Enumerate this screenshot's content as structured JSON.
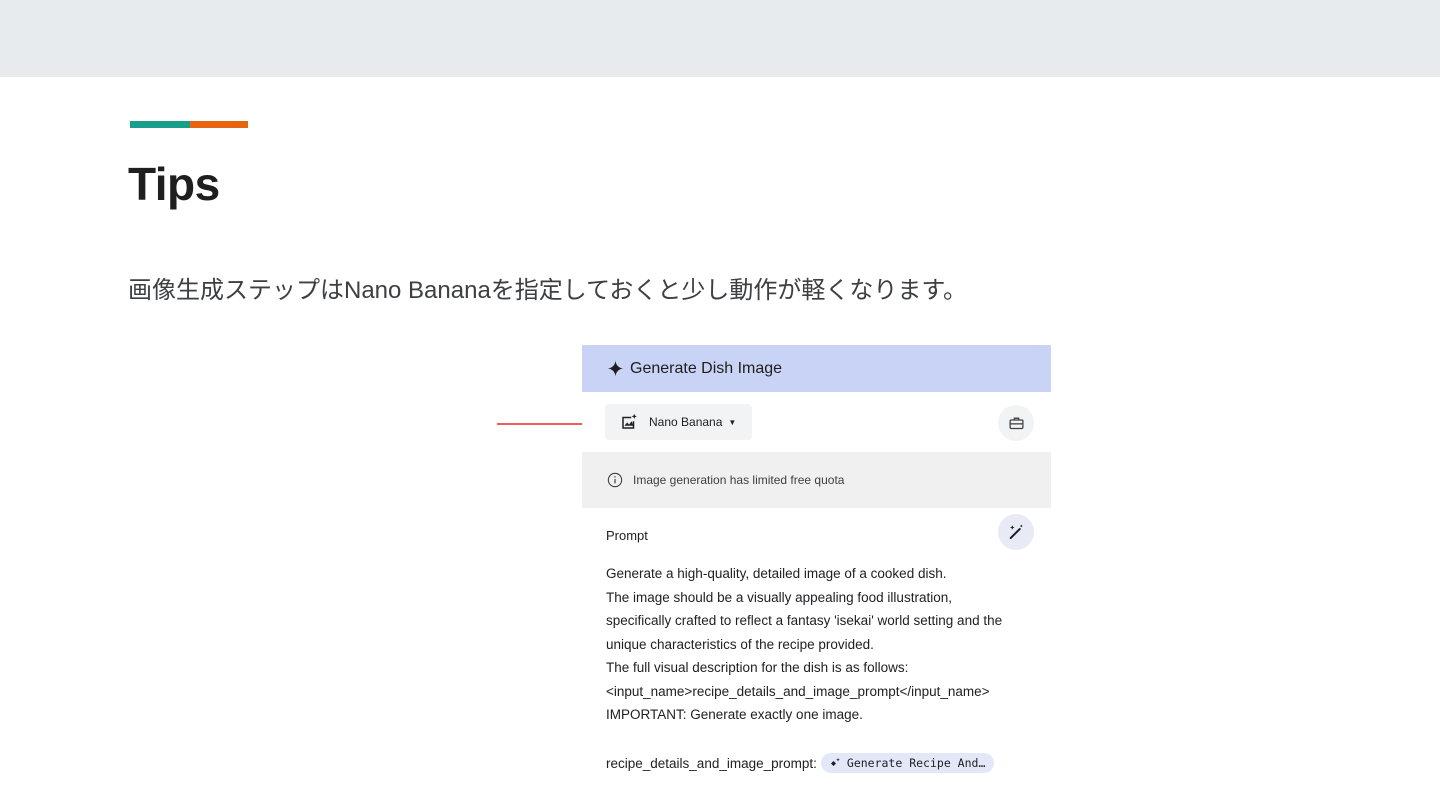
{
  "slide": {
    "title": "Tips",
    "subtitle": "画像生成ステップはNano Bananaを指定しておくと少し動作が軽くなります。",
    "accent_colors": [
      "#1a9e8c",
      "#e8650f"
    ],
    "pointer_color": "#e8262c"
  },
  "panel": {
    "header_title": "Generate Dish Image",
    "header_icon": "sparkle-icon",
    "model_selector": {
      "label": "Nano Banana",
      "icon": "image-generation-icon"
    },
    "toolbar_icon": "toolbox-icon",
    "notice": {
      "icon": "info-icon",
      "text": "Image generation has limited free quota"
    },
    "prompt": {
      "label": "Prompt",
      "action_icon": "magic-wand-icon",
      "lines": [
        "Generate a high-quality, detailed image of a cooked dish.",
        "The image should be a visually appealing food illustration,",
        "specifically crafted to reflect a fantasy 'isekai' world setting and the",
        "unique characteristics of the recipe provided.",
        "The full visual description for the dish is as follows:",
        "<input_name>recipe_details_and_image_prompt</input_name>",
        "IMPORTANT: Generate exactly one image."
      ],
      "variable_name": "recipe_details_and_image_prompt:",
      "variable_chip": "Generate Recipe And…"
    }
  }
}
